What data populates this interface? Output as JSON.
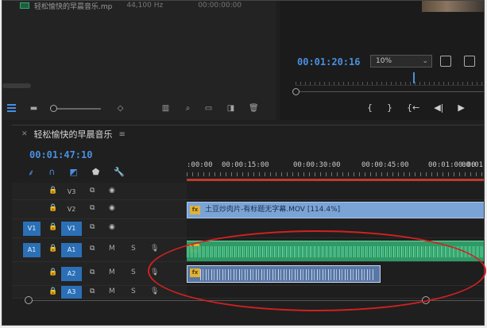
{
  "project": {
    "file_name": "轻松愉快的早晨音乐.mp",
    "sample_rate": "44,100 Hz",
    "duration": "00:00:00:00"
  },
  "program": {
    "timecode": "00:01:20:16",
    "zoom": "10%",
    "transport": [
      "{",
      "}",
      "{←",
      "◀|",
      "▶"
    ]
  },
  "timeline": {
    "sequence_name": "轻松愉快的早晨音乐",
    "timecode": "00:01:47:10",
    "ruler_labels": [
      ":00:00",
      "00:00:15:00",
      "00:00:30:00",
      "00:00:45:00",
      "00:01:00:00",
      "00:01:15:00"
    ],
    "tracks": [
      {
        "target": "V3",
        "type": "video"
      },
      {
        "target": "V2",
        "type": "video"
      },
      {
        "source": "V1",
        "target": "V1",
        "type": "video"
      },
      {
        "source": "A1",
        "target": "A1",
        "type": "audio"
      },
      {
        "target": "A2",
        "type": "audio"
      },
      {
        "target": "A3",
        "type": "audio"
      }
    ],
    "m_label": "M",
    "s_label": "S",
    "video_clip": "土豆炒肉片-有标题无字幕.MOV [114.4%]",
    "fx_label": "fx"
  },
  "colors": {
    "accent_blue": "#4a8fe0",
    "video_clip": "#7ba4d6",
    "audio_clip_green": "#2f9a66",
    "audio_clip_blue": "#5877a5",
    "annotation_red": "#d32020"
  }
}
